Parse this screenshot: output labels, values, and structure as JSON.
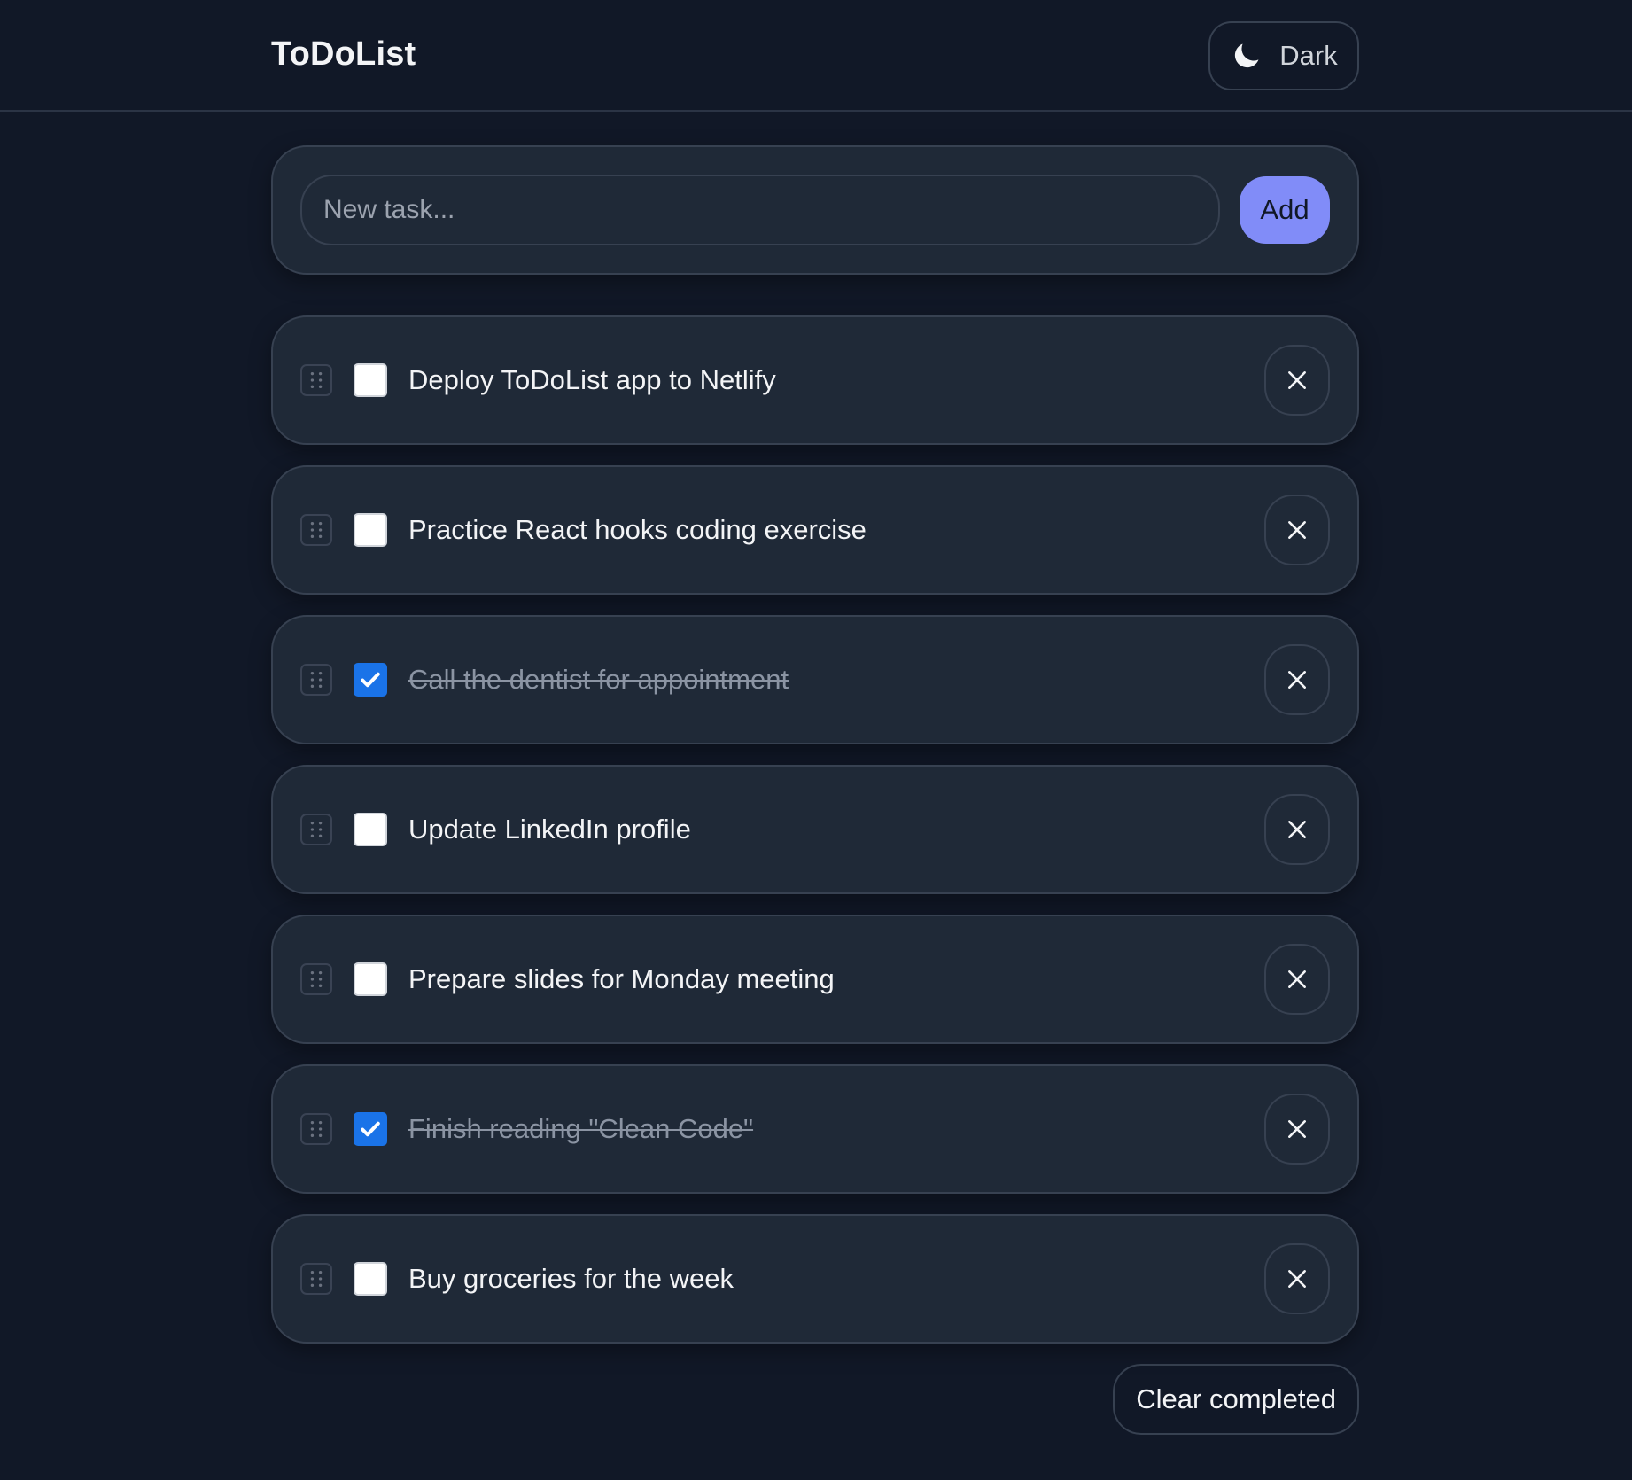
{
  "header": {
    "title": "ToDoList",
    "theme_label": "Dark",
    "theme_icon": "moon-icon"
  },
  "composer": {
    "placeholder": "New task...",
    "value": "",
    "add_label": "Add"
  },
  "tasks": [
    {
      "text": "Deploy ToDoList app to Netlify",
      "completed": false
    },
    {
      "text": "Practice React hooks coding exercise",
      "completed": false
    },
    {
      "text": "Call the dentist for appointment",
      "completed": true
    },
    {
      "text": "Update LinkedIn profile",
      "completed": false
    },
    {
      "text": "Prepare slides for Monday meeting",
      "completed": false
    },
    {
      "text": "Finish reading \"Clean Code\"",
      "completed": true
    },
    {
      "text": "Buy groceries for the week",
      "completed": false
    }
  ],
  "footer": {
    "clear_label": "Clear completed"
  },
  "colors": {
    "background": "#111827",
    "panel": "#1f2937",
    "border": "#374151",
    "accent": "#818cf8",
    "checkbox_checked": "#1a73e8",
    "text": "#f3f4f6",
    "muted_text": "#8b94a3"
  },
  "icons": {
    "drag": "drag-handle-icon",
    "check": "check-icon",
    "delete": "close-icon"
  }
}
